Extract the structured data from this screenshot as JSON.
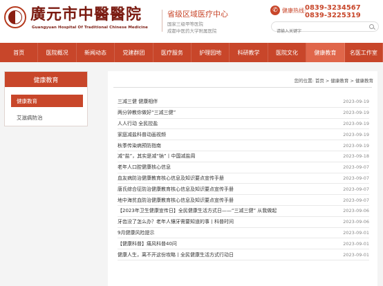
{
  "header": {
    "logo_cn": "廣元市中醫醫院",
    "logo_en": "Guangyuan Hospital Of Traditional Chinese Medicine",
    "level": "省级区域医疗中心",
    "sub_lines": [
      "国家三级甲等医院",
      "成都中医药大学附属医院"
    ],
    "hotline_label": "健康热线:",
    "hotlines": [
      "0839-3234567",
      "0839-3225319"
    ],
    "search_placeholder": "请输入关键字"
  },
  "nav": {
    "items": [
      "首页",
      "医院概况",
      "新闻动态",
      "党建群团",
      "医疗服务",
      "护理园地",
      "科研教学",
      "医院文化",
      "健康教育",
      "名医工作室"
    ],
    "active_index": 8
  },
  "sidebar": {
    "title": "健康教育",
    "items": [
      {
        "label": "健康教育",
        "active": true
      },
      {
        "label": "艾滋病防治",
        "active": false
      }
    ]
  },
  "breadcrumb": "您的位置: 首页 > 健康教育 > 健康教育",
  "articles": [
    {
      "title": "三减三健 健康相伴",
      "date": "2023-09-19"
    },
    {
      "title": "两分钟教你做好“三减三健”",
      "date": "2023-09-19"
    },
    {
      "title": "人人行动 全民控盐",
      "date": "2023-09-19"
    },
    {
      "title": "家庭减盐科普动画视频",
      "date": "2023-09-19"
    },
    {
      "title": "秋季传染病预防指南",
      "date": "2023-09-19"
    },
    {
      "title": "减“盐”，其实是减“钠”丨中国减盐周",
      "date": "2023-09-18"
    },
    {
      "title": "老年人口腔健康核心信息",
      "date": "2023-09-07"
    },
    {
      "title": "血友病防治健康教育核心信息及知识要点宣传手册",
      "date": "2023-09-07"
    },
    {
      "title": "唐氏综合征防治健康教育核心信息及知识要点宣传手册",
      "date": "2023-09-07"
    },
    {
      "title": "地中海贫血防治健康教育核心信息及知识要点宣传手册",
      "date": "2023-09-07"
    },
    {
      "title": "【2023年卫生健康宣传日】全民健康生活方式日——“三减三健” 从我做起",
      "date": "2023-09-06"
    },
    {
      "title": "牙齿没了怎么办？老年人镶牙需要知道的事丨科普时间",
      "date": "2023-09-06"
    },
    {
      "title": "9月健康风险提示",
      "date": "2023-09-01"
    },
    {
      "title": "【健康科普】痛风科普40问",
      "date": "2023-09-01"
    },
    {
      "title": "健康人生，离不开这份攻略丨全民健康生活方式行动日",
      "date": "2023-09-01"
    }
  ]
}
